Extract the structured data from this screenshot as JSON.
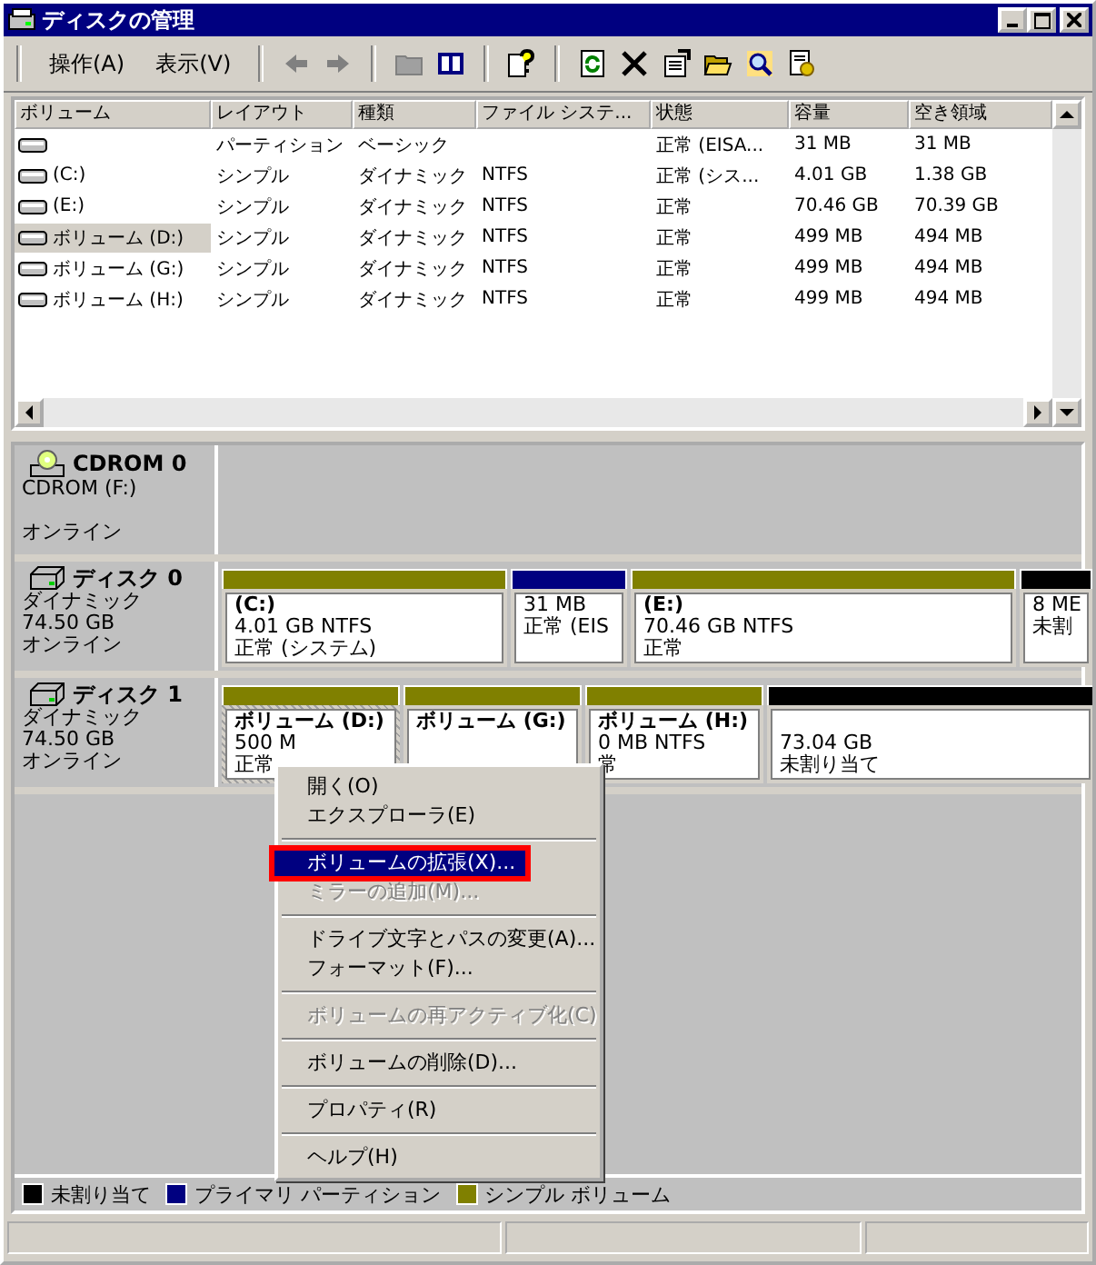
{
  "window": {
    "title": "ディスクの管理"
  },
  "menu": [
    {
      "label": "操作(A)"
    },
    {
      "label": "表示(V)"
    }
  ],
  "toolbar": [
    {
      "kind": "back",
      "disabled": true
    },
    {
      "kind": "forward",
      "disabled": true
    },
    {
      "kind": "separator"
    },
    {
      "kind": "folder",
      "disabled": true
    },
    {
      "kind": "panel",
      "disabled": false
    },
    {
      "kind": "separator"
    },
    {
      "kind": "help",
      "disabled": false
    },
    {
      "kind": "separator"
    },
    {
      "kind": "refresh",
      "disabled": false
    },
    {
      "kind": "delete",
      "disabled": false
    },
    {
      "kind": "properties",
      "disabled": false
    },
    {
      "kind": "open",
      "disabled": false
    },
    {
      "kind": "search",
      "disabled": false
    },
    {
      "kind": "settings",
      "disabled": false
    }
  ],
  "table": {
    "columns": [
      "ボリューム",
      "レイアウト",
      "種類",
      "ファイル システ...",
      "状態",
      "容量",
      "空き領域"
    ],
    "rows": [
      {
        "cells": [
          "",
          "パーティション",
          "ベーシック",
          "",
          "正常 (EISA...",
          "31 MB",
          "31 MB"
        ],
        "selected": false
      },
      {
        "cells": [
          "(C:)",
          "シンプル",
          "ダイナミック",
          "NTFS",
          "正常 (シス...",
          "4.01 GB",
          "1.38 GB"
        ],
        "selected": false
      },
      {
        "cells": [
          "(E:)",
          "シンプル",
          "ダイナミック",
          "NTFS",
          "正常",
          "70.46 GB",
          "70.39 GB"
        ],
        "selected": false
      },
      {
        "cells": [
          "ボリューム (D:)",
          "シンプル",
          "ダイナミック",
          "NTFS",
          "正常",
          "499 MB",
          "494 MB"
        ],
        "selected": true
      },
      {
        "cells": [
          "ボリューム (G:)",
          "シンプル",
          "ダイナミック",
          "NTFS",
          "正常",
          "499 MB",
          "494 MB"
        ],
        "selected": false
      },
      {
        "cells": [
          "ボリューム (H:)",
          "シンプル",
          "ダイナミック",
          "NTFS",
          "正常",
          "499 MB",
          "494 MB"
        ],
        "selected": false
      }
    ]
  },
  "disks": [
    {
      "kind": "cdrom",
      "name": "CDROM 0",
      "lines": [
        "CDROM (F:)",
        "オンライン"
      ]
    },
    {
      "kind": "disk",
      "name": "ディスク 0",
      "lines": [
        "ダイナミック",
        "74.50 GB",
        "オンライン"
      ],
      "partitions": [
        {
          "kind": "volume",
          "title": "(C:)",
          "lines": [
            "4.01 GB NTFS",
            "正常 (システム)"
          ],
          "color": "#808000",
          "selected": false
        },
        {
          "kind": "volume",
          "lines": [
            "31 MB",
            "正常 (EIS"
          ],
          "color": "#000080",
          "selected": false
        },
        {
          "kind": "volume",
          "title": "(E:)",
          "lines": [
            "70.46 GB NTFS",
            "正常"
          ],
          "color": "#808000",
          "selected": false
        },
        {
          "kind": "volume",
          "lines": [
            "8 ME",
            "未割"
          ],
          "color": "#000000",
          "selected": false
        }
      ]
    },
    {
      "kind": "disk",
      "name": "ディスク 1",
      "lines": [
        "ダイナミック",
        "74.50 GB",
        "オンライン"
      ],
      "partitions": [
        {
          "kind": "volume",
          "title": "ボリューム (D:)",
          "lines": [
            "500 M",
            "正常"
          ],
          "color": "#808000",
          "selected": true
        },
        {
          "kind": "volume",
          "title": "ボリューム (G:)",
          "color": "#808000",
          "selected": false
        },
        {
          "kind": "volume",
          "title": "ボリューム (H:)",
          "lines": [
            "0 MB NTFS",
            "常"
          ],
          "color": "#808000",
          "selected": false
        },
        {
          "kind": "unallocated",
          "lines": [
            "73.04 GB",
            "未割り当て"
          ],
          "color": "#000000",
          "selected": false
        }
      ]
    }
  ],
  "context_menu": [
    {
      "kind": "item",
      "label": "開く(O)",
      "disabled": false,
      "selected": false
    },
    {
      "kind": "item",
      "label": "エクスプローラ(E)",
      "disabled": false,
      "selected": false
    },
    {
      "kind": "separator"
    },
    {
      "kind": "item",
      "label": "ボリュームの拡張(X)...",
      "disabled": false,
      "selected": true,
      "highlighted": true
    },
    {
      "kind": "item",
      "label": "ミラーの追加(M)...",
      "disabled": true,
      "selected": false
    },
    {
      "kind": "separator"
    },
    {
      "kind": "item",
      "label": "ドライブ文字とパスの変更(A)...",
      "disabled": false,
      "selected": false
    },
    {
      "kind": "item",
      "label": "フォーマット(F)...",
      "disabled": false,
      "selected": false
    },
    {
      "kind": "separator"
    },
    {
      "kind": "item",
      "label": "ボリュームの再アクティブ化(C)",
      "disabled": true,
      "selected": false
    },
    {
      "kind": "separator"
    },
    {
      "kind": "item",
      "label": "ボリュームの削除(D)...",
      "disabled": false,
      "selected": false
    },
    {
      "kind": "separator"
    },
    {
      "kind": "item",
      "label": "プロパティ(R)",
      "disabled": false,
      "selected": false
    },
    {
      "kind": "separator"
    },
    {
      "kind": "item",
      "label": "ヘルプ(H)",
      "disabled": false,
      "selected": false
    }
  ],
  "legend": [
    {
      "label": "未割り当て",
      "color": "#000000"
    },
    {
      "label": "プライマリ パーティション",
      "color": "#000080"
    },
    {
      "label": "シンプル ボリューム",
      "color": "#808000"
    }
  ]
}
